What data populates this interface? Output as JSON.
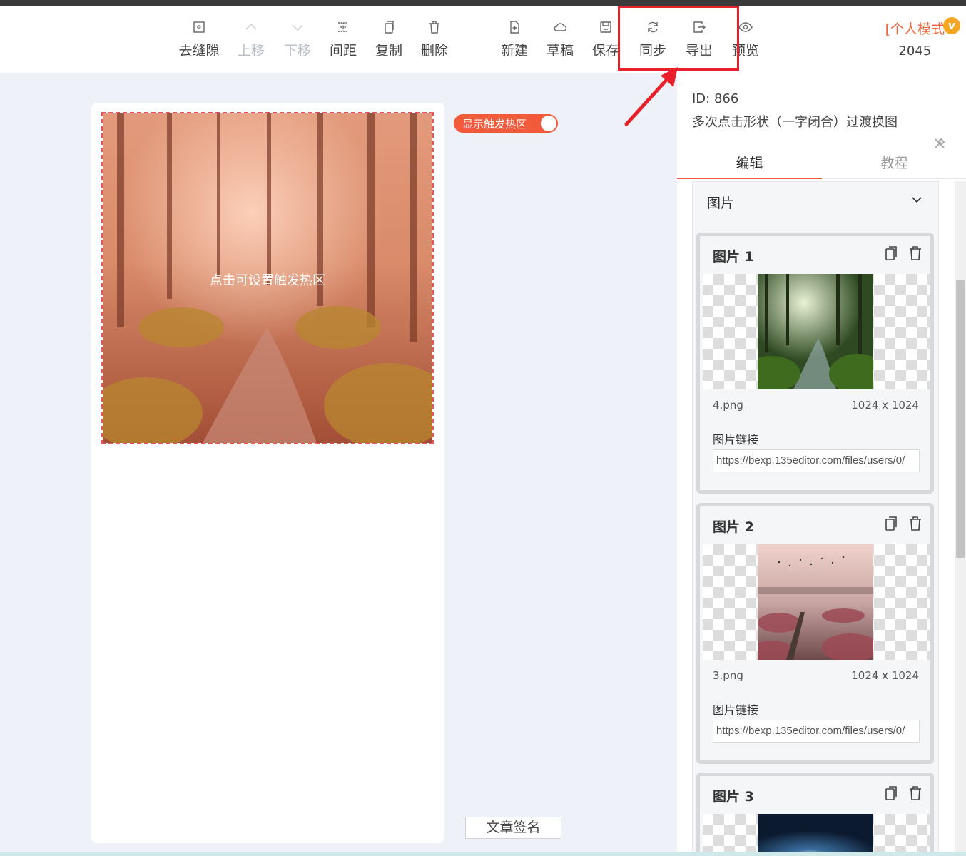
{
  "toolbar": {
    "items": [
      {
        "label": "去缝隙",
        "icon": "gap-icon",
        "disabled": false
      },
      {
        "label": "上移",
        "icon": "chevron-up-icon",
        "disabled": true
      },
      {
        "label": "下移",
        "icon": "chevron-down-icon",
        "disabled": true
      },
      {
        "label": "间距",
        "icon": "spacing-icon",
        "disabled": false
      },
      {
        "label": "复制",
        "icon": "copy-icon",
        "disabled": false
      },
      {
        "label": "删除",
        "icon": "trash-icon",
        "disabled": false
      },
      {
        "label": "新建",
        "icon": "new-file-icon",
        "disabled": false
      },
      {
        "label": "草稿",
        "icon": "cloud-icon",
        "disabled": false
      },
      {
        "label": "保存",
        "icon": "save-icon",
        "disabled": false
      },
      {
        "label": "同步",
        "icon": "sync-icon",
        "disabled": false
      },
      {
        "label": "导出",
        "icon": "export-icon",
        "disabled": false
      },
      {
        "label": "预览",
        "icon": "eye-icon",
        "disabled": false
      }
    ],
    "mode_label": "[个人模式",
    "vip_badge": "v",
    "mode_number": "2045"
  },
  "canvas": {
    "hotspot_text": "点击可设置触发热区",
    "toggle_label": "显示触发热区",
    "signature_button": "文章签名"
  },
  "panel": {
    "id_text": "ID: 866",
    "title": "多次点击形状（一字闭合）过渡换图",
    "tabs": [
      "编辑",
      "教程"
    ],
    "section_title": "图片",
    "cards": [
      {
        "title": "图片 1",
        "filename": "4.png",
        "size": "1024 x 1024",
        "link_label": "图片链接",
        "link": "https://bexp.135editor.com/files/users/0/"
      },
      {
        "title": "图片 2",
        "filename": "3.png",
        "size": "1024 x 1024",
        "link_label": "图片链接",
        "link": "https://bexp.135editor.com/files/users/0/"
      },
      {
        "title": "图片 3"
      }
    ]
  },
  "colors": {
    "accent": "#f15a3b",
    "highlight": "#e8202a",
    "vip": "#f5a623"
  }
}
